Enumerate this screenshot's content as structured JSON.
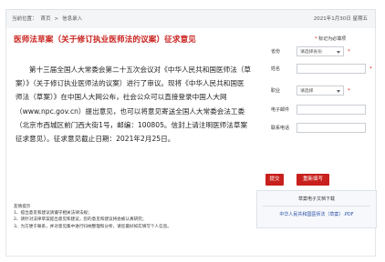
{
  "breadcrumb": {
    "location_label": "当前位置：",
    "home": "首页",
    "separator": ">",
    "current": "信息录入",
    "date": "2021年1月30日 星期五"
  },
  "article": {
    "title": "医师法草案（关于修订执业医师法的议案）征求意见",
    "notice": "第十三届全国人大常委会第二十五次会议对《中华人民共和国医师法（草案）》（关于修订执业医师法的议案）进行了审议。现将《中华人民共和国医师法（草案）》在中国人大网公布，社会公众可以直接登录中国人大网（www.npc.gov.cn）提出意见，也可以将意见寄送全国人大常委会法工委（北京市西城区前门西大街1号，邮编：100805。信封上请注明医师法草案征求意见）。征求意见截止日期：2021年2月25日。"
  },
  "tips": {
    "heading": "友情提示",
    "items": [
      "1、提出意见和建议请遵守相关法律法规；",
      "2、请针对法律草案提出意见和建议，您的意见和建议将会被认真研究；",
      "3、为方便于联系，并对意见集中进行归纳整理和分析，请您最好如实填写个人信息。"
    ]
  },
  "form": {
    "required_note": "标记为必填项",
    "required_mark": "*",
    "province_label": "省份",
    "province_value": "请选择省份",
    "name_label": "姓名",
    "occupation_label": "职业",
    "occupation_value": "请选择",
    "email_label": "电子邮件",
    "phone_label": "联系电话",
    "submit_label": "提交",
    "reset_label": "重新填写"
  },
  "download": {
    "title": "草案电子文档下载",
    "link": "中华人民共和国医师法（草案）.PDF"
  },
  "colors": {
    "title": "#c8201c",
    "button": "#c8201c",
    "required": "#dd2211",
    "link": "#2a4fa8"
  }
}
